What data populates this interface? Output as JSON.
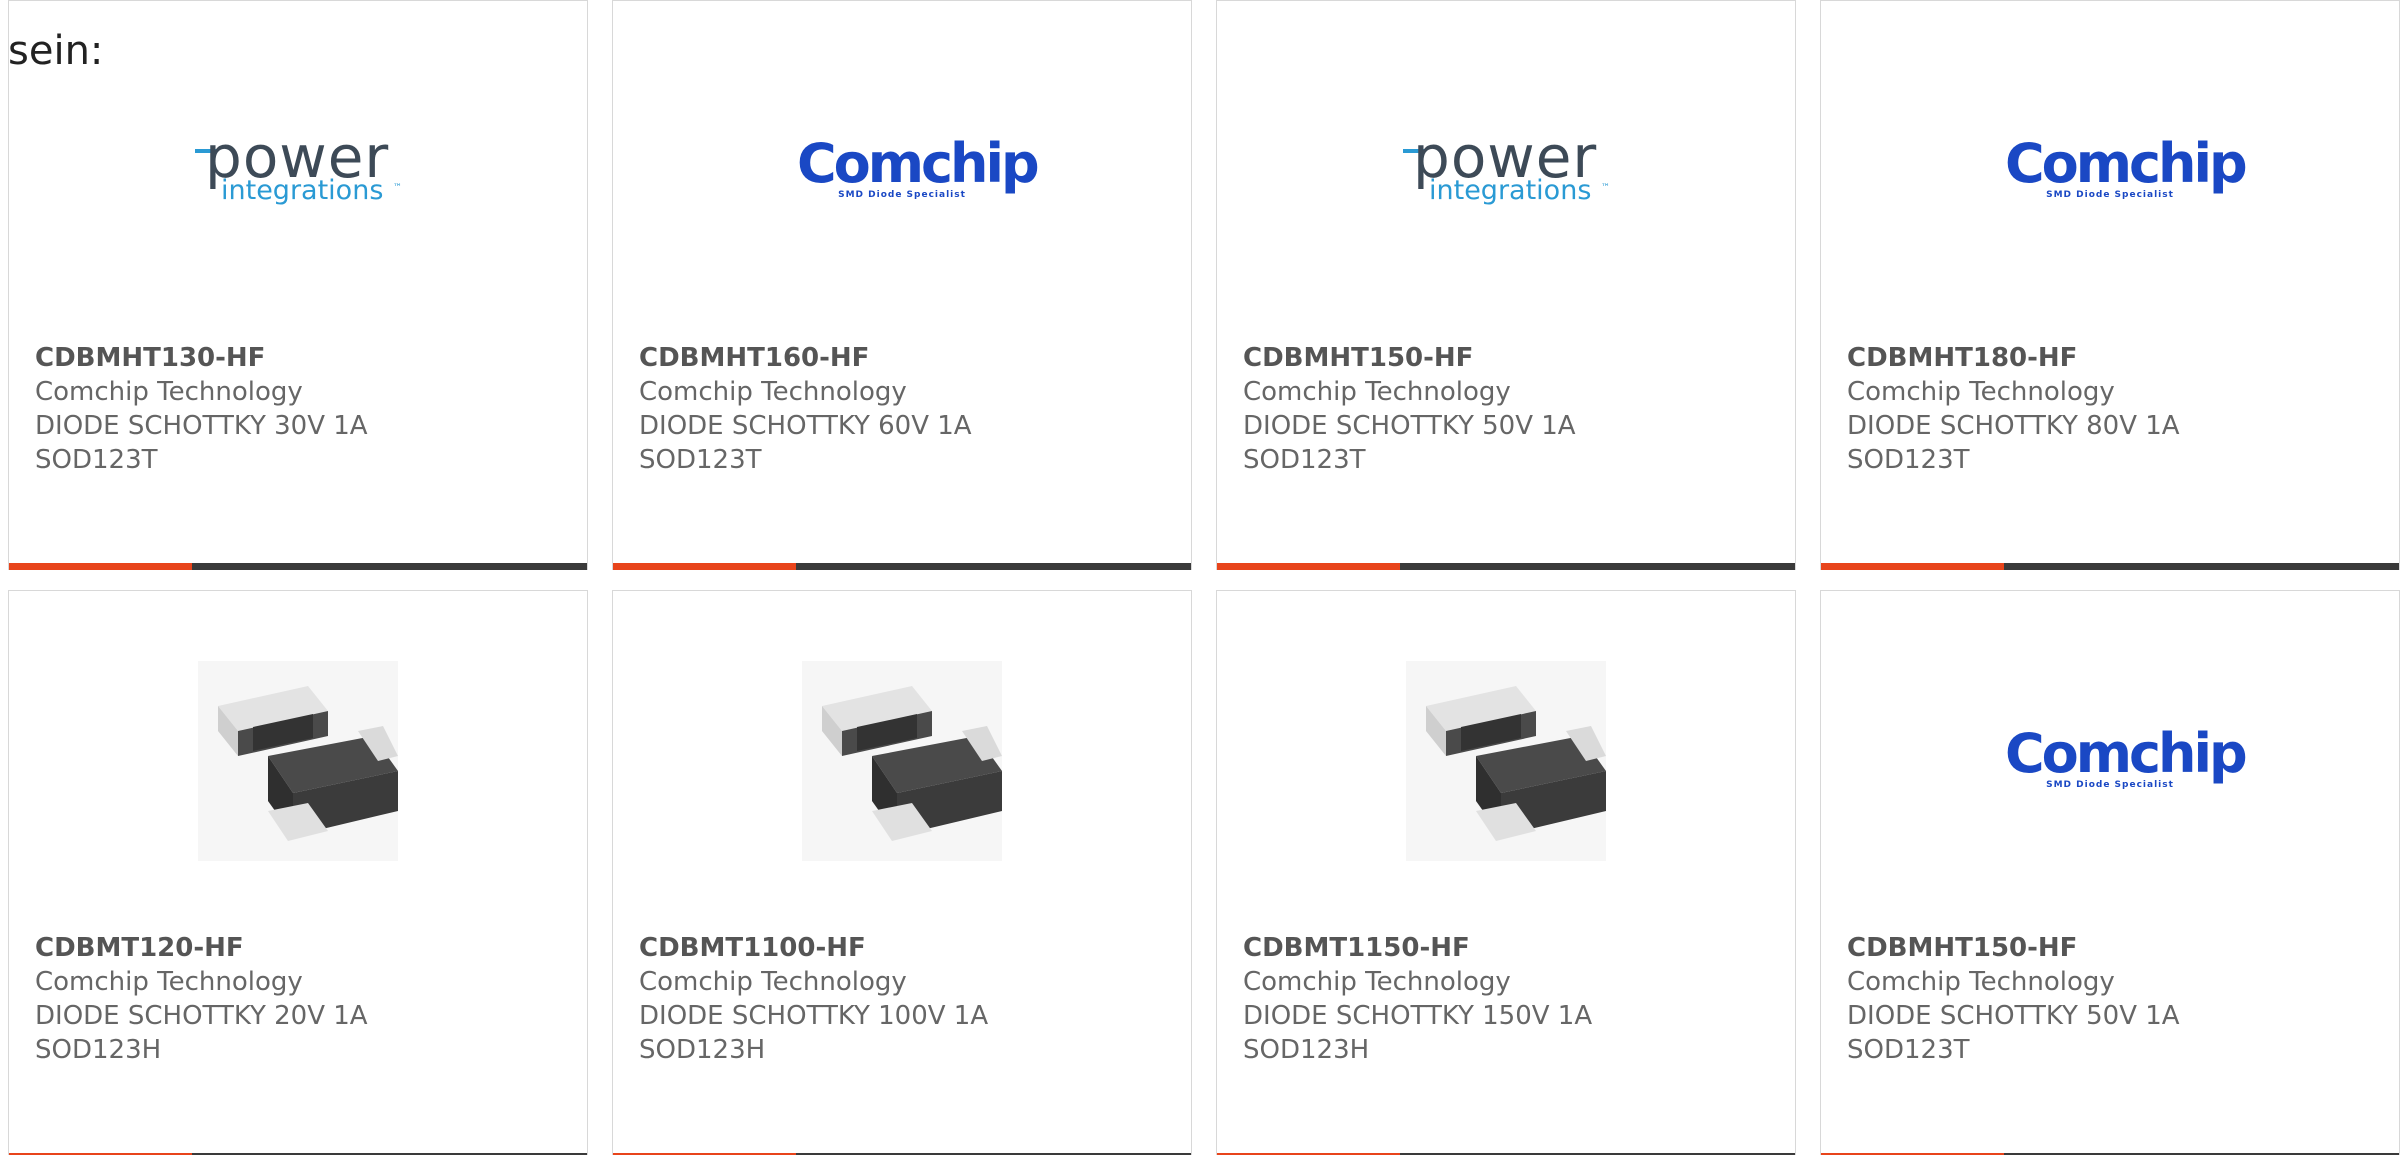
{
  "intro": {
    "text": "sein:"
  },
  "logos": {
    "power_integrations": {
      "word": "power",
      "sub": "integrations",
      "tm": "™"
    },
    "comchip": {
      "word": "Comchip",
      "sub": "SMD Diode Specialist"
    }
  },
  "colors": {
    "accent": "#e8441b",
    "bar": "#3a3a3a",
    "text": "#666666",
    "comchip_blue": "#1a48c4",
    "pi_blue": "#2a9ad4"
  },
  "products": [
    {
      "part": "CDBMHT130-HF",
      "maker": "Comchip Technology",
      "desc": "DIODE SCHOTTKY 30V 1A",
      "pkg": "SOD123T",
      "image": "power-integrations-logo"
    },
    {
      "part": "CDBMHT160-HF",
      "maker": "Comchip Technology",
      "desc": "DIODE SCHOTTKY 60V 1A",
      "pkg": "SOD123T",
      "image": "comchip-logo"
    },
    {
      "part": "CDBMHT150-HF",
      "maker": "Comchip Technology",
      "desc": "DIODE SCHOTTKY 50V 1A",
      "pkg": "SOD123T",
      "image": "power-integrations-logo"
    },
    {
      "part": "CDBMHT180-HF",
      "maker": "Comchip Technology",
      "desc": "DIODE SCHOTTKY 80V 1A",
      "pkg": "SOD123T",
      "image": "comchip-logo"
    },
    {
      "part": "CDBMT120-HF",
      "maker": "Comchip Technology",
      "desc": "DIODE SCHOTTKY 20V 1A",
      "pkg": "SOD123H",
      "image": "smd-diode-photo"
    },
    {
      "part": "CDBMT1100-HF",
      "maker": "Comchip Technology",
      "desc": "DIODE SCHOTTKY 100V 1A",
      "pkg": "SOD123H",
      "image": "smd-diode-photo"
    },
    {
      "part": "CDBMT1150-HF",
      "maker": "Comchip Technology",
      "desc": "DIODE SCHOTTKY 150V 1A",
      "pkg": "SOD123H",
      "image": "smd-diode-photo"
    },
    {
      "part": "CDBMHT150-HF",
      "maker": "Comchip Technology",
      "desc": "DIODE SCHOTTKY 50V 1A",
      "pkg": "SOD123T",
      "image": "comchip-logo"
    }
  ]
}
